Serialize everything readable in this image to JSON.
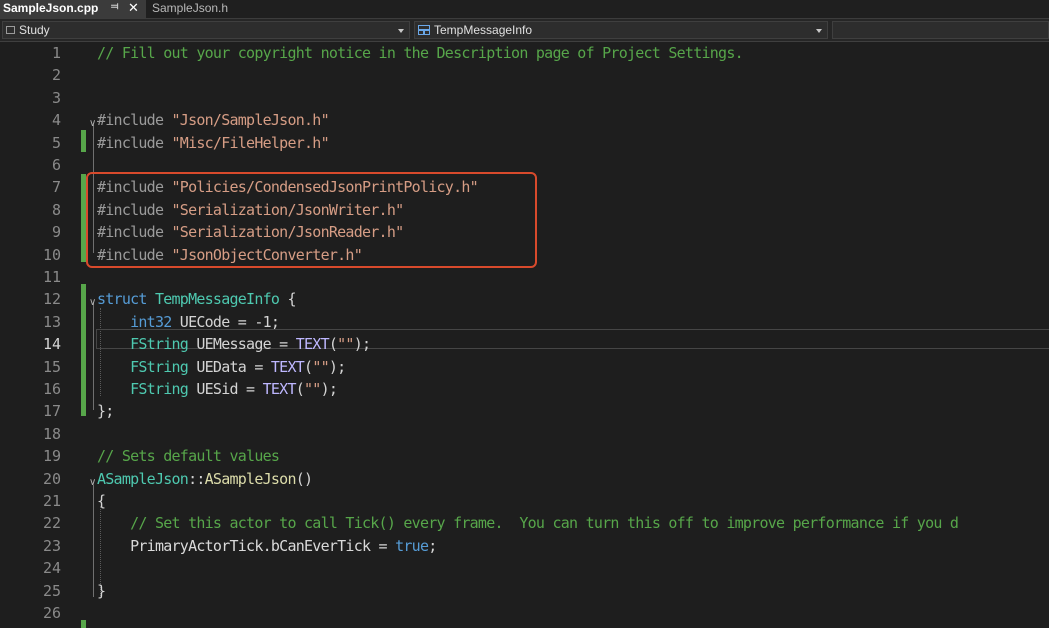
{
  "tabs": [
    {
      "label": "SampleJson.cpp",
      "active": true
    },
    {
      "label": "SampleJson.h",
      "active": false
    }
  ],
  "tab_icons": {
    "pin": "pin-icon",
    "close": "close-icon"
  },
  "navbar": {
    "project": "Study",
    "scope": "TempMessageInfo",
    "member": ""
  },
  "editor": {
    "current_line": 14,
    "highlight_box_color": "#d84a2c",
    "lines": [
      {
        "n": "1",
        "tokens": [
          {
            "t": "// Fill out your copyright notice in the Description page of Project Settings.",
            "c": "cm"
          }
        ]
      },
      {
        "n": "2",
        "tokens": []
      },
      {
        "n": "3",
        "tokens": []
      },
      {
        "n": "4",
        "fold": "v",
        "tokens": [
          {
            "t": "#include ",
            "c": "pp"
          },
          {
            "t": "\"Json/SampleJson.h\"",
            "c": "str"
          }
        ]
      },
      {
        "n": "5",
        "tokens": [
          {
            "t": "#include ",
            "c": "pp"
          },
          {
            "t": "\"Misc/FileHelper.h\"",
            "c": "str"
          }
        ]
      },
      {
        "n": "6",
        "tokens": []
      },
      {
        "n": "7",
        "tokens": [
          {
            "t": "#include ",
            "c": "pp"
          },
          {
            "t": "\"Policies/CondensedJsonPrintPolicy.h\"",
            "c": "str"
          }
        ]
      },
      {
        "n": "8",
        "tokens": [
          {
            "t": "#include ",
            "c": "pp"
          },
          {
            "t": "\"Serialization/JsonWriter.h\"",
            "c": "str"
          }
        ]
      },
      {
        "n": "9",
        "tokens": [
          {
            "t": "#include ",
            "c": "pp"
          },
          {
            "t": "\"Serialization/JsonReader.h\"",
            "c": "str"
          }
        ]
      },
      {
        "n": "10",
        "tokens": [
          {
            "t": "#include ",
            "c": "pp"
          },
          {
            "t": "\"JsonObjectConverter.h\"",
            "c": "str"
          }
        ]
      },
      {
        "n": "11",
        "tokens": []
      },
      {
        "n": "12",
        "fold": "v",
        "tokens": [
          {
            "t": "struct ",
            "c": "kw"
          },
          {
            "t": "TempMessageInfo",
            "c": "ty"
          },
          {
            "t": " {",
            "c": "p"
          }
        ]
      },
      {
        "n": "13",
        "tokens": [
          {
            "t": "    ",
            "c": "p"
          },
          {
            "t": "int32",
            "c": "kw"
          },
          {
            "t": " UECode = -1;",
            "c": "p"
          }
        ]
      },
      {
        "n": "14",
        "tokens": [
          {
            "t": "    ",
            "c": "p"
          },
          {
            "t": "FString",
            "c": "ty"
          },
          {
            "t": " UEMessage = ",
            "c": "p"
          },
          {
            "t": "TEXT",
            "c": "mac"
          },
          {
            "t": "(",
            "c": "p"
          },
          {
            "t": "\"\"",
            "c": "str"
          },
          {
            "t": ");",
            "c": "p"
          }
        ]
      },
      {
        "n": "15",
        "tokens": [
          {
            "t": "    ",
            "c": "p"
          },
          {
            "t": "FString",
            "c": "ty"
          },
          {
            "t": " UEData = ",
            "c": "p"
          },
          {
            "t": "TEXT",
            "c": "mac"
          },
          {
            "t": "(",
            "c": "p"
          },
          {
            "t": "\"\"",
            "c": "str"
          },
          {
            "t": ");",
            "c": "p"
          }
        ]
      },
      {
        "n": "16",
        "tokens": [
          {
            "t": "    ",
            "c": "p"
          },
          {
            "t": "FString",
            "c": "ty"
          },
          {
            "t": " UESid = ",
            "c": "p"
          },
          {
            "t": "TEXT",
            "c": "mac"
          },
          {
            "t": "(",
            "c": "p"
          },
          {
            "t": "\"\"",
            "c": "str"
          },
          {
            "t": ");",
            "c": "p"
          }
        ]
      },
      {
        "n": "17",
        "tokens": [
          {
            "t": "};",
            "c": "p"
          }
        ]
      },
      {
        "n": "18",
        "tokens": []
      },
      {
        "n": "19",
        "tokens": [
          {
            "t": "// Sets default values",
            "c": "cm"
          }
        ]
      },
      {
        "n": "20",
        "fold": "v",
        "tokens": [
          {
            "t": "ASampleJson",
            "c": "ty"
          },
          {
            "t": "::",
            "c": "p"
          },
          {
            "t": "ASampleJson",
            "c": "fn"
          },
          {
            "t": "()",
            "c": "p"
          }
        ]
      },
      {
        "n": "21",
        "tokens": [
          {
            "t": "{",
            "c": "p"
          }
        ]
      },
      {
        "n": "22",
        "tokens": [
          {
            "t": "    ",
            "c": "p"
          },
          {
            "t": "// Set this actor to call Tick() every frame.  You can turn this off to improve performance if you d",
            "c": "cm"
          }
        ]
      },
      {
        "n": "23",
        "tokens": [
          {
            "t": "    ",
            "c": "p"
          },
          {
            "t": "PrimaryActorTick",
            "c": "var"
          },
          {
            "t": ".",
            "c": "p"
          },
          {
            "t": "bCanEverTick",
            "c": "var"
          },
          {
            "t": " = ",
            "c": "p"
          },
          {
            "t": "true",
            "c": "kw"
          },
          {
            "t": ";",
            "c": "p"
          }
        ]
      },
      {
        "n": "24",
        "tokens": []
      },
      {
        "n": "25",
        "tokens": [
          {
            "t": "}",
            "c": "p"
          }
        ]
      },
      {
        "n": "26",
        "tokens": []
      }
    ]
  }
}
